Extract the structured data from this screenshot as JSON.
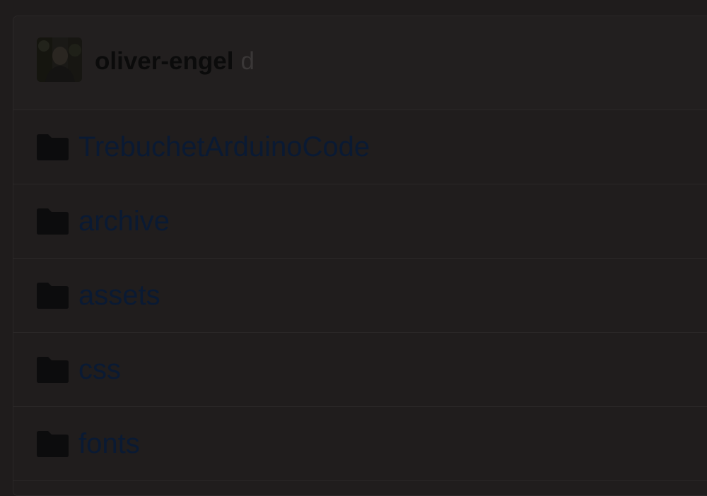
{
  "commit": {
    "author": "oliver-engel",
    "message": "d"
  },
  "files": [
    {
      "name": "TrebuchetArduinoCode",
      "icon": "folder-icon"
    },
    {
      "name": "archive",
      "icon": "folder-icon"
    },
    {
      "name": "assets",
      "icon": "folder-icon"
    },
    {
      "name": "css",
      "icon": "folder-icon"
    },
    {
      "name": "fonts",
      "icon": "folder-icon"
    }
  ],
  "colors": {
    "background": "#1f1c1c",
    "link": "#0a1a33",
    "author": "#0b0b0b",
    "folder": "#0c0c0d"
  }
}
